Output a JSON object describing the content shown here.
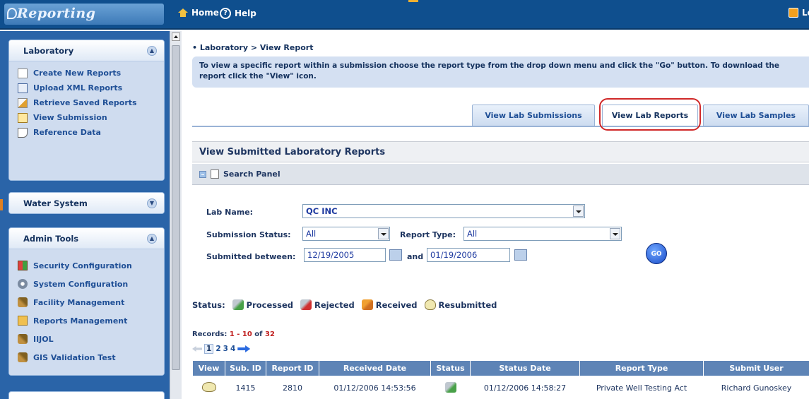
{
  "app": {
    "logo_text": "Reporting"
  },
  "topnav": {
    "home_label": "Home",
    "help_label": "Help",
    "logout_label": "Lo"
  },
  "sidebar": {
    "laboratory": {
      "title": "Laboratory",
      "items": [
        {
          "label": "Create New Reports",
          "icon": "new-report-icon"
        },
        {
          "label": "Upload XML Reports",
          "icon": "xml-upload-icon"
        },
        {
          "label": "Retrieve Saved Reports",
          "icon": "edit-report-icon"
        },
        {
          "label": "View Submission",
          "icon": "view-submission-icon"
        },
        {
          "label": "Reference Data",
          "icon": "reference-doc-icon"
        }
      ]
    },
    "water_system": {
      "title": "Water System"
    },
    "admin_tools": {
      "title": "Admin Tools",
      "items": [
        {
          "label": "Security Configuration",
          "icon": "security-icon"
        },
        {
          "label": "System Configuration",
          "icon": "gear-icon"
        },
        {
          "label": "Facility Management",
          "icon": "wrench-icon"
        },
        {
          "label": "Reports Management",
          "icon": "folder-icon"
        },
        {
          "label": "IIJOL",
          "icon": "wrench-icon"
        },
        {
          "label": "GIS Validation Test",
          "icon": "wrench-icon"
        }
      ]
    }
  },
  "main": {
    "breadcrumb": "Laboratory > View Report",
    "info_text": "To view a specific report within a submission choose the report type from the drop down menu and click the \"Go\" button. To download the report click the \"View\" icon.",
    "tabs": [
      {
        "label": "View Lab Submissions",
        "active": false
      },
      {
        "label": "View Lab Reports",
        "active": true
      },
      {
        "label": "View Lab Samples",
        "active": false
      }
    ],
    "section_title": "View Submitted Laboratory Reports",
    "search_panel_label": "Search Panel",
    "form": {
      "lab_name_label": "Lab Name:",
      "lab_name_value": "QC INC",
      "submission_status_label": "Submission Status:",
      "submission_status_value": "All",
      "report_type_label": "Report Type:",
      "report_type_value": "All",
      "submitted_between_label": "Submitted between:",
      "date_from": "12/19/2005",
      "and_label": "and",
      "date_to": "01/19/2006",
      "go_label": "GO"
    },
    "status_legend": {
      "label": "Status:",
      "items": [
        "Processed",
        "Rejected",
        "Received",
        "Resubmitted"
      ]
    },
    "records": {
      "prefix": "Records:",
      "range": "1 - 10",
      "of_label": "of",
      "total": "32"
    },
    "pager": {
      "pages": [
        "1",
        "2",
        "3",
        "4"
      ],
      "current": "1"
    },
    "table": {
      "columns": [
        "View",
        "Sub. ID",
        "Report ID",
        "Received Date",
        "Status",
        "Status Date",
        "Report Type",
        "Submit User"
      ],
      "rows": [
        {
          "sub_id": "1415",
          "report_id": "2810",
          "received_date": "01/12/2006 14:53:56",
          "status_date": "01/12/2006 14:58:27",
          "report_type": "Private Well Testing Act",
          "submit_user": "Richard Gunoskey"
        }
      ]
    }
  },
  "colors": {
    "topbar": "#0f4f8e",
    "sidebar": "#2a64a8",
    "table_header": "#5e84b6",
    "highlight": "#d02828"
  }
}
